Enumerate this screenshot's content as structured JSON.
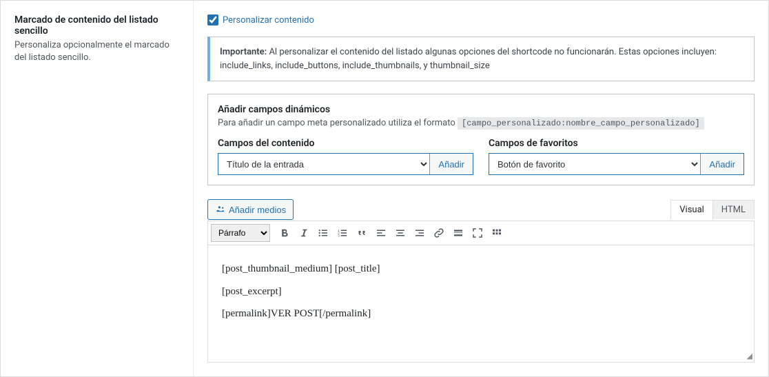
{
  "sidebar": {
    "title": "Marcado de contenido del listado sencillo",
    "description": "Personaliza opcionalmente el marcado del listado sencillo."
  },
  "checkbox": {
    "label": "Personalizar contenido"
  },
  "notice": {
    "strong": "Importante:",
    "text": "Al personalizar el contenido del listado algunas opciones del shortcode no funcionarán. Estas opciones incluyen: include_links, include_buttons, include_thumbnails, y thumbnail_size"
  },
  "dynamic_fields": {
    "title": "Añadir campos dinámicos",
    "help_text": "Para añadir un campo meta personalizado utiliza el formato",
    "help_code": "[campo_personalizado:nombre_campo_personalizado]",
    "content_fields": {
      "label": "Campos del contenido",
      "selected": "Título de la entrada",
      "button": "Añadir"
    },
    "favorite_fields": {
      "label": "Campos de favoritos",
      "selected": "Botón de favorito",
      "button": "Añadir"
    }
  },
  "editor": {
    "add_media": "Añadir medios",
    "tabs": {
      "visual": "Visual",
      "html": "HTML"
    },
    "format": "Párrafo",
    "content": {
      "line1": "[post_thumbnail_medium] [post_title]",
      "line2": "[post_excerpt]",
      "line3": "[permalink]VER POST[/permalink]"
    }
  }
}
